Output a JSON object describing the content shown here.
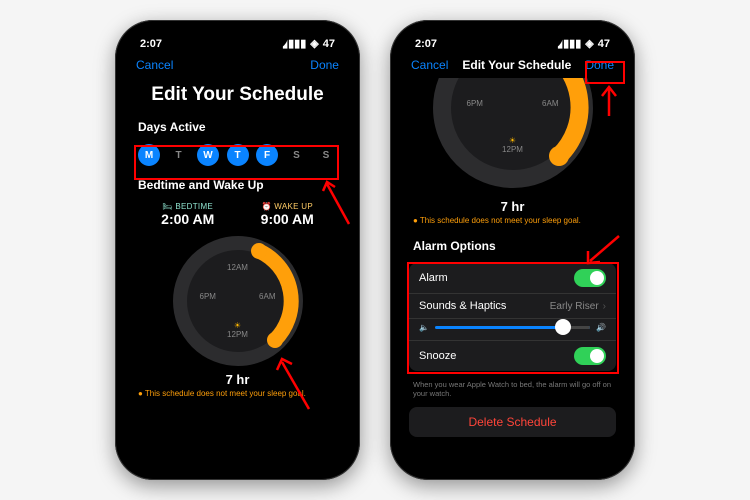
{
  "status": {
    "time": "2:07",
    "battery": "47"
  },
  "nav": {
    "cancel": "Cancel",
    "done": "Done",
    "title_small": "Edit Your Schedule"
  },
  "title": "Edit Your Schedule",
  "days": {
    "label": "Days Active",
    "items": [
      "M",
      "T",
      "W",
      "T",
      "F",
      "S",
      "S"
    ],
    "active": [
      true,
      false,
      true,
      true,
      true,
      false,
      false
    ]
  },
  "bedwake": {
    "label": "Bedtime and Wake Up",
    "bed_label": "BEDTIME",
    "bed_time": "2:00 AM",
    "wake_label": "WAKE UP",
    "wake_time": "9:00 AM"
  },
  "dial": {
    "t12am": "12AM",
    "t6pm": "6PM",
    "t6am": "6AM",
    "t12pm": "12PM"
  },
  "duration": "7 hr",
  "goal_msg": "This schedule does not meet your sleep goal.",
  "alarm": {
    "section": "Alarm Options",
    "alarm_label": "Alarm",
    "sounds_label": "Sounds & Haptics",
    "sounds_value": "Early Riser",
    "snooze_label": "Snooze"
  },
  "note": "When you wear Apple Watch to bed, the alarm will go off on your watch.",
  "delete": "Delete Schedule"
}
